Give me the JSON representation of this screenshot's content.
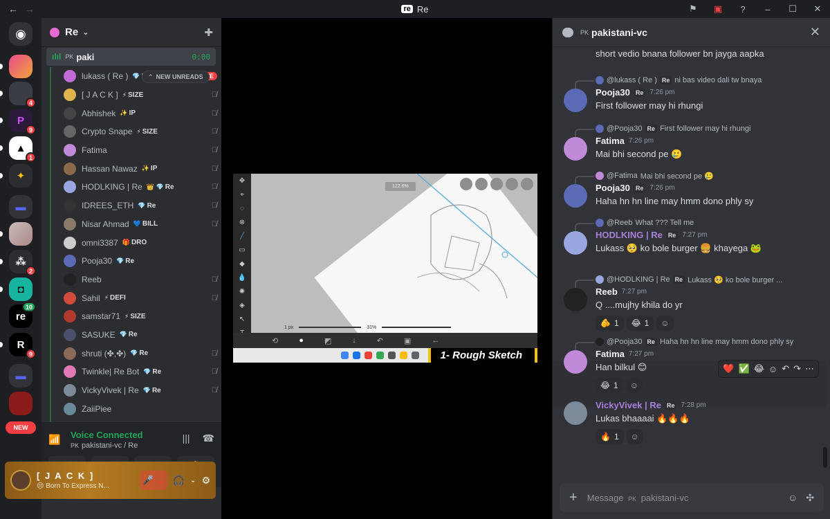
{
  "titlebar": {
    "back": "←",
    "forward": "→",
    "logo": "re",
    "title": "Re",
    "icons": [
      "flag-icon",
      "inbox-icon",
      "help-icon",
      "minimize-icon",
      "maximize-icon",
      "close-icon"
    ]
  },
  "guilds": {
    "badges": {
      "g2": "4",
      "g3": "9",
      "g4": "1",
      "g8": "2",
      "g9": "10",
      "g10": "9"
    },
    "new_pill": "NEW"
  },
  "server": {
    "name": "Re",
    "chevron": "⌄"
  },
  "voice_channel": {
    "prefix": "PK",
    "name": "paki",
    "timer": "0:00",
    "unread_pill": "NEW UNREADS"
  },
  "members": [
    {
      "name": "lukass ( Re )",
      "tag": "Re",
      "tag_icon": "💎",
      "live": "LIVE",
      "color": "#c26bd6"
    },
    {
      "name": "[ J A C K ]",
      "tag": "SIZE",
      "tag_icon": "⚡",
      "color": "#e1b34c"
    },
    {
      "name": "Abhishek",
      "tag": "IP",
      "tag_icon": "✨",
      "color": "#444"
    },
    {
      "name": "Crypto Snape",
      "tag": "SIZE",
      "tag_icon": "⚡",
      "color": "#666"
    },
    {
      "name": "Fatima",
      "tag": "",
      "tag_icon": "",
      "color": "#c08ad8"
    },
    {
      "name": "Hassan Nawaz",
      "tag": "IP",
      "tag_icon": "✨",
      "color": "#8a6a4a"
    },
    {
      "name": "HODLKING | Re",
      "tag": "Re",
      "tag_icon": "👑 💎",
      "color": "#9aa6e0"
    },
    {
      "name": "IDREES_ETH",
      "tag": "Re",
      "tag_icon": "💎",
      "color": "#333"
    },
    {
      "name": "Nisar Ahmad",
      "tag": "BILL",
      "tag_icon": "💙",
      "color": "#8c7b6b"
    },
    {
      "name": "omni3387",
      "tag": "DRO",
      "tag_icon": "🎁",
      "color": "#ccc"
    },
    {
      "name": "Pooja30",
      "tag": "Re",
      "tag_icon": "💎",
      "color": "#5b6ab5"
    },
    {
      "name": "Reeb",
      "tag": "",
      "tag_icon": "",
      "color": "#222"
    },
    {
      "name": "Sahil",
      "tag": "DEFI",
      "tag_icon": "⚡",
      "color": "#d24c3d"
    },
    {
      "name": "samstar71",
      "tag": "SIZE",
      "tag_icon": "⚡",
      "color": "#b03a2e"
    },
    {
      "name": "SASUKE",
      "tag": "Re",
      "tag_icon": "💎",
      "color": "#4a4f6b"
    },
    {
      "name": "shruti (✤,✤)",
      "tag": "Re",
      "tag_icon": "💎",
      "color": "#8b6a5a"
    },
    {
      "name": "Twinkle| Re Bot",
      "tag": "Re",
      "tag_icon": "💎",
      "color": "#e07ab5"
    },
    {
      "name": "VickyVivek | Re",
      "tag": "Re",
      "tag_icon": "💎",
      "color": "#7c8a9a"
    },
    {
      "name": "ZaiiPiee",
      "tag": "",
      "tag_icon": "",
      "color": "#6a8a9a"
    }
  ],
  "voice_panel": {
    "status": "Voice Connected",
    "prefix": "PK",
    "channel": "pakistani-vc / Re"
  },
  "user_panel": {
    "name": "[ J A C K ]",
    "status": "😒 Born To Express N..."
  },
  "stream": {
    "zoom": "122.6%",
    "brush_size": "1 px",
    "opacity": "31%",
    "label": "1- Rough Sketch",
    "tool_names": [
      "Transform",
      "Magic Wand",
      "Lasso",
      "Filter",
      "Brush",
      "Eraser",
      "Smudge",
      "Blur",
      "Special",
      "Bucket",
      "Vector",
      "Text"
    ]
  },
  "chat": {
    "prefix": "PK",
    "channel": "pakistani-vc",
    "top_text": "short vedio bnana follower bn jaygа aapka",
    "composer_placeholder": "Message",
    "composer_channel": "pakistani-vc",
    "messages": [
      {
        "reply_name": "@lukass ( Re )",
        "reply_tag": "Re",
        "reply_text": "ni bas video dali tw bnaya",
        "author": "Pooja30",
        "tag": "Re",
        "time": "7:26 pm",
        "text": "First follower may hi rhungi",
        "author_color": "#f2f3f5"
      },
      {
        "reply_name": "@Pooja30",
        "reply_tag": "Re",
        "reply_text": "First follower may hi rhungi",
        "author": "Fatima",
        "tag": "",
        "time": "7:26 pm",
        "text": "Mai bhi second pe 🥲",
        "author_color": "#f2f3f5"
      },
      {
        "reply_name": "@Fatima",
        "reply_tag": "",
        "reply_text": "Mai bhi second pe 🥲",
        "author": "Pooja30",
        "tag": "Re",
        "time": "7:26 pm",
        "text": "Haha hn hn line may hmm dono phly sy",
        "author_color": "#f2f3f5"
      },
      {
        "reply_name": "@Reeb",
        "reply_tag": "",
        "reply_text": "What ??? Tell me",
        "author": "HODLKING | Re",
        "tag": "Re",
        "time": "7:27 pm",
        "text": "Lukass 🥺 ko bole burger 🍔 khayega 🐸",
        "author_color": "#a881dc"
      },
      {
        "reply_name": "@HODLKING | Re",
        "reply_tag": "Re",
        "reply_text": "Lukass 🥺 ko bole burger ...",
        "author": "Reeb",
        "tag": "",
        "time": "7:27 pm",
        "text": "Q ....mujhy khila do yr",
        "author_color": "#f2f3f5",
        "reactions": [
          {
            "emoji": "🫵",
            "count": "1"
          },
          {
            "emoji": "😂",
            "count": "1"
          }
        ]
      },
      {
        "reply_name": "@Pooja30",
        "reply_tag": "Re",
        "reply_text": "Haha hn hn line may hmm dono phly sy",
        "author": "Fatima",
        "tag": "",
        "time": "7:27 pm",
        "text": "Han bilkul 😊",
        "author_color": "#f2f3f5",
        "reactions": [
          {
            "emoji": "😂",
            "count": "1"
          }
        ]
      },
      {
        "reply_name": "",
        "reply_tag": "",
        "reply_text": "",
        "author": "VickyVivek | Re",
        "tag": "Re",
        "time": "7:28 pm",
        "text": "Lukas bhaaaai 🔥🔥🔥",
        "author_color": "#a881dc",
        "reactions": [
          {
            "emoji": "🔥",
            "count": "1"
          }
        ]
      }
    ],
    "hover_toolbar": [
      "❤️",
      "✅",
      "😂",
      "☺",
      "↶",
      "↷",
      "⋯"
    ]
  }
}
